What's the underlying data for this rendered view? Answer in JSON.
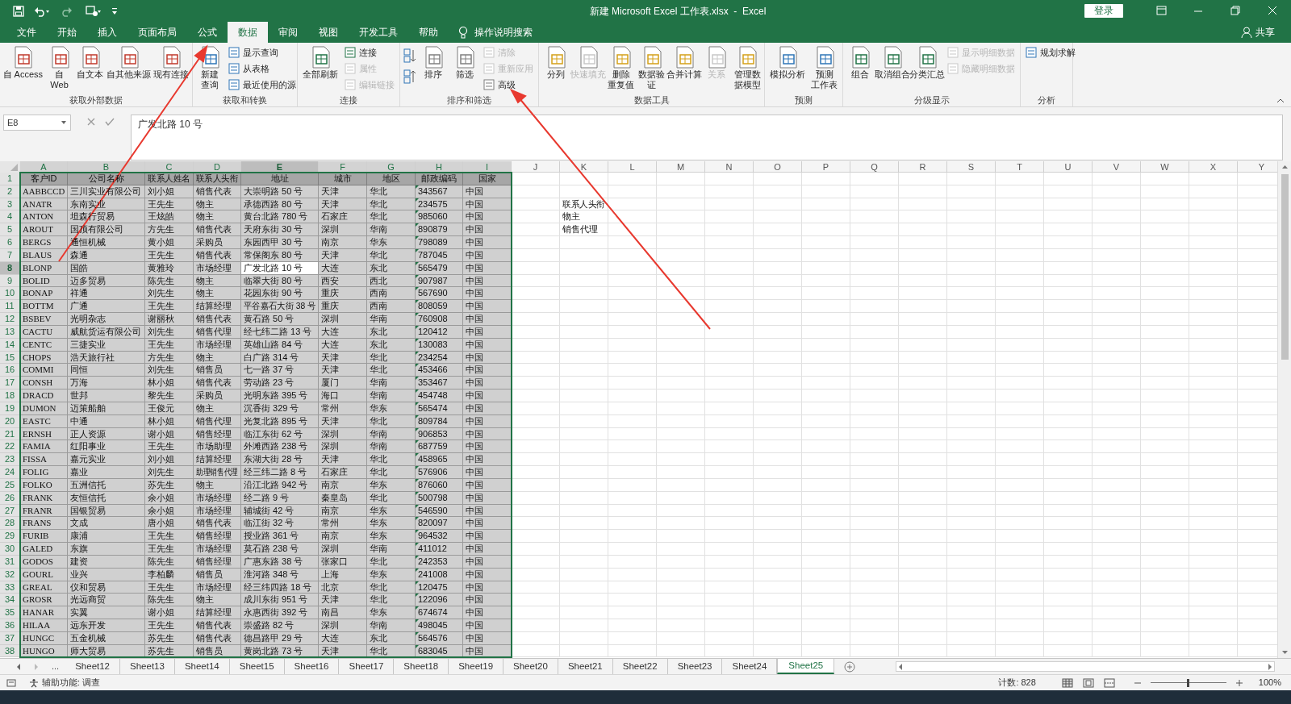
{
  "window": {
    "title": "新建 Microsoft Excel 工作表.xlsx  -  Excel",
    "sign_in": "登录"
  },
  "menu_tabs": [
    {
      "label": "文件",
      "selected": false
    },
    {
      "label": "开始",
      "selected": false
    },
    {
      "label": "插入",
      "selected": false
    },
    {
      "label": "页面布局",
      "selected": false
    },
    {
      "label": "公式",
      "selected": false
    },
    {
      "label": "数据",
      "selected": true
    },
    {
      "label": "审阅",
      "selected": false
    },
    {
      "label": "视图",
      "selected": false
    },
    {
      "label": "开发工具",
      "selected": false
    },
    {
      "label": "帮助",
      "selected": false
    }
  ],
  "tell_me": "操作说明搜索",
  "share": "共享",
  "ribbon_groups": [
    {
      "label": "获取外部数据",
      "items": [
        {
          "label": "自 Access",
          "kind": "large",
          "disabled": false
        },
        {
          "lines": [
            "自",
            "Web"
          ],
          "kind": "large",
          "disabled": false
        },
        {
          "label": "自文本",
          "kind": "large",
          "disabled": false
        },
        {
          "label": "自其他来源",
          "kind": "large",
          "disabled": false
        },
        {
          "label": "现有连接",
          "kind": "large",
          "disabled": false
        }
      ]
    },
    {
      "label": "获取和转换",
      "items": [
        {
          "lines": [
            "新建",
            "查询"
          ],
          "kind": "large",
          "disabled": false
        },
        {
          "label": "显示查询",
          "kind": "small",
          "disabled": false
        },
        {
          "label": "从表格",
          "kind": "small",
          "disabled": false
        },
        {
          "label": "最近使用的源",
          "kind": "small",
          "disabled": false
        }
      ]
    },
    {
      "label": "连接",
      "items": [
        {
          "label": "全部刷新",
          "kind": "large",
          "disabled": false
        },
        {
          "label": "连接",
          "kind": "small",
          "disabled": false
        },
        {
          "label": "属性",
          "kind": "small",
          "disabled": true
        },
        {
          "label": "编辑链接",
          "kind": "small",
          "disabled": true
        }
      ]
    },
    {
      "label": "排序和筛选",
      "items": [
        {
          "kind": "sort_pair"
        },
        {
          "label": "排序",
          "kind": "large",
          "disabled": false
        },
        {
          "label": "筛选",
          "kind": "large",
          "disabled": false
        },
        {
          "label": "清除",
          "kind": "small",
          "disabled": true
        },
        {
          "label": "重新应用",
          "kind": "small",
          "disabled": true
        },
        {
          "label": "高级",
          "kind": "small",
          "disabled": false
        }
      ]
    },
    {
      "label": "数据工具",
      "items": [
        {
          "label": "分列",
          "kind": "large",
          "disabled": false
        },
        {
          "label": "快速填充",
          "kind": "large",
          "disabled": true
        },
        {
          "lines": [
            "删除",
            "重复值"
          ],
          "kind": "large",
          "disabled": false
        },
        {
          "lines": [
            "数据验",
            "证"
          ],
          "kind": "large",
          "disabled": false
        },
        {
          "label": "合并计算",
          "kind": "large",
          "disabled": false
        },
        {
          "label": "关系",
          "kind": "large",
          "disabled": true
        },
        {
          "lines": [
            "管理数",
            "据模型"
          ],
          "kind": "large",
          "disabled": false
        }
      ]
    },
    {
      "label": "预测",
      "items": [
        {
          "label": "模拟分析",
          "kind": "large",
          "disabled": false
        },
        {
          "lines": [
            "预测",
            "工作表"
          ],
          "kind": "large",
          "disabled": false
        }
      ]
    },
    {
      "label": "分级显示",
      "items": [
        {
          "label": "组合",
          "kind": "large",
          "disabled": false
        },
        {
          "label": "取消组合",
          "kind": "large",
          "disabled": false
        },
        {
          "label": "分类汇总",
          "kind": "large",
          "disabled": false
        },
        {
          "label": "显示明细数据",
          "kind": "small",
          "disabled": true
        },
        {
          "label": "隐藏明细数据",
          "kind": "small",
          "disabled": true
        }
      ]
    },
    {
      "label": "分析",
      "items": [
        {
          "label": "规划求解",
          "kind": "small",
          "disabled": false
        }
      ]
    }
  ],
  "name_box": "E8",
  "formula": "广发北路 10 号",
  "sheet": {
    "column_letters": [
      {
        "label": "A",
        "selected": false
      },
      {
        "label": "B",
        "selected": false
      },
      {
        "label": "C",
        "selected": false
      },
      {
        "label": "D",
        "selected": false
      },
      {
        "label": "E",
        "selected": true
      },
      {
        "label": "F",
        "selected": false
      },
      {
        "label": "G",
        "selected": false
      },
      {
        "label": "H",
        "selected": false
      },
      {
        "label": "I",
        "selected": false
      },
      {
        "label": "J",
        "selected": false
      },
      {
        "label": "K",
        "selected": false
      },
      {
        "label": "L",
        "selected": false
      },
      {
        "label": "M",
        "selected": false
      },
      {
        "label": "N",
        "selected": false
      },
      {
        "label": "O",
        "selected": false
      },
      {
        "label": "P",
        "selected": false
      },
      {
        "label": "Q",
        "selected": false
      },
      {
        "label": "R",
        "selected": false
      },
      {
        "label": "S",
        "selected": false
      },
      {
        "label": "T",
        "selected": false
      },
      {
        "label": "U",
        "selected": false
      },
      {
        "label": "V",
        "selected": false
      },
      {
        "label": "W",
        "selected": false
      },
      {
        "label": "X",
        "selected": false
      },
      {
        "label": "Y",
        "selected": false
      }
    ],
    "header": [
      "客户ID",
      "公司名称",
      "联系人姓名",
      "联系人头衔",
      "地址",
      "城市",
      "地区",
      "邮政编码",
      "国家"
    ],
    "rows": [
      {
        "number": "2",
        "selected": false,
        "cells": [
          "AABBCCD",
          "三川实业有限公司",
          "刘小姐",
          "销售代表",
          "大崇明路 50 号",
          "天津",
          "华北",
          "343567",
          "中国"
        ]
      },
      {
        "number": "3",
        "selected": false,
        "cells": [
          "ANATR",
          "东南实业",
          "王先生",
          "物主",
          "承德西路 80 号",
          "天津",
          "华北",
          "234575",
          "中国"
        ]
      },
      {
        "number": "4",
        "selected": false,
        "cells": [
          "ANTON",
          "坦森行贸易",
          "王炫皓",
          "物主",
          "黄台北路 780 号",
          "石家庄",
          "华北",
          "985060",
          "中国"
        ]
      },
      {
        "number": "5",
        "selected": false,
        "cells": [
          "AROUT",
          "国顶有限公司",
          "方先生",
          "销售代表",
          "天府东街 30 号",
          "深圳",
          "华南",
          "890879",
          "中国"
        ]
      },
      {
        "number": "6",
        "selected": false,
        "cells": [
          "BERGS",
          "通恒机械",
          "黄小姐",
          "采购员",
          "东园西甲 30 号",
          "南京",
          "华东",
          "798089",
          "中国"
        ]
      },
      {
        "number": "7",
        "selected": false,
        "cells": [
          "BLAUS",
          "森通",
          "王先生",
          "销售代表",
          "常保阁东 80 号",
          "天津",
          "华北",
          "787045",
          "中国"
        ]
      },
      {
        "number": "8",
        "selected": true,
        "cells": [
          "BLONP",
          "国皓",
          "黄雅玲",
          "市场经理",
          "广发北路 10 号",
          "大连",
          "东北",
          "565479",
          "中国"
        ]
      },
      {
        "number": "9",
        "selected": false,
        "cells": [
          "BOLID",
          "迈多贸易",
          "陈先生",
          "物主",
          "临翠大街 80 号",
          "西安",
          "西北",
          "907987",
          "中国"
        ]
      },
      {
        "number": "10",
        "selected": false,
        "cells": [
          "BONAP",
          "祥通",
          "刘先生",
          "物主",
          "花园东街 90 号",
          "重庆",
          "西南",
          "567690",
          "中国"
        ]
      },
      {
        "number": "11",
        "selected": false,
        "cells": [
          "BOTTM",
          "广通",
          "王先生",
          "结算经理",
          "平谷嘉石大街 38 号",
          "重庆",
          "西南",
          "808059",
          "中国"
        ]
      },
      {
        "number": "12",
        "selected": false,
        "cells": [
          "BSBEV",
          "光明杂志",
          "谢丽秋",
          "销售代表",
          "黄石路 50 号",
          "深圳",
          "华南",
          "760908",
          "中国"
        ]
      },
      {
        "number": "13",
        "selected": false,
        "cells": [
          "CACTU",
          "威航货运有限公司",
          "刘先生",
          "销售代理",
          "经七纬二路 13 号",
          "大连",
          "东北",
          "120412",
          "中国"
        ]
      },
      {
        "number": "14",
        "selected": false,
        "cells": [
          "CENTC",
          "三捷实业",
          "王先生",
          "市场经理",
          "英雄山路 84 号",
          "大连",
          "东北",
          "130083",
          "中国"
        ]
      },
      {
        "number": "15",
        "selected": false,
        "cells": [
          "CHOPS",
          "浩天旅行社",
          "方先生",
          "物主",
          "白广路 314 号",
          "天津",
          "华北",
          "234254",
          "中国"
        ]
      },
      {
        "number": "16",
        "selected": false,
        "cells": [
          "COMMI",
          "同恒",
          "刘先生",
          "销售员",
          "七一路 37 号",
          "天津",
          "华北",
          "453466",
          "中国"
        ]
      },
      {
        "number": "17",
        "selected": false,
        "cells": [
          "CONSH",
          "万海",
          "林小姐",
          "销售代表",
          "劳动路 23 号",
          "厦门",
          "华南",
          "353467",
          "中国"
        ]
      },
      {
        "number": "18",
        "selected": false,
        "cells": [
          "DRACD",
          "世邦",
          "黎先生",
          "采购员",
          "光明东路 395 号",
          "海口",
          "华南",
          "454748",
          "中国"
        ]
      },
      {
        "number": "19",
        "selected": false,
        "cells": [
          "DUMON",
          "迈策船舶",
          "王俊元",
          "物主",
          "沉香街 329 号",
          "常州",
          "华东",
          "565474",
          "中国"
        ]
      },
      {
        "number": "20",
        "selected": false,
        "cells": [
          "EASTC",
          "中通",
          "林小姐",
          "销售代理",
          "光复北路 895 号",
          "天津",
          "华北",
          "809784",
          "中国"
        ]
      },
      {
        "number": "21",
        "selected": false,
        "cells": [
          "ERNSH",
          "正人资源",
          "谢小姐",
          "销售经理",
          "临江东街 62 号",
          "深圳",
          "华南",
          "906853",
          "中国"
        ]
      },
      {
        "number": "22",
        "selected": false,
        "cells": [
          "FAMIA",
          "红阳事业",
          "王先生",
          "市场助理",
          "外滩西路 238 号",
          "深圳",
          "华南",
          "687759",
          "中国"
        ]
      },
      {
        "number": "23",
        "selected": false,
        "cells": [
          "FISSA",
          "嘉元实业",
          "刘小姐",
          "结算经理",
          "东湖大街 28 号",
          "天津",
          "华北",
          "458965",
          "中国"
        ]
      },
      {
        "number": "24",
        "selected": false,
        "cells": [
          "FOLIG",
          "嘉业",
          "刘先生",
          "助理销售代理",
          "经三纬二路 8 号",
          "石家庄",
          "华北",
          "576906",
          "中国"
        ]
      },
      {
        "number": "25",
        "selected": false,
        "cells": [
          "FOLKO",
          "五洲信托",
          "苏先生",
          "物主",
          "沿江北路 942 号",
          "南京",
          "华东",
          "876060",
          "中国"
        ]
      },
      {
        "number": "26",
        "selected": false,
        "cells": [
          "FRANK",
          "友恒信托",
          "余小姐",
          "市场经理",
          "经二路 9 号",
          "秦皇岛",
          "华北",
          "500798",
          "中国"
        ]
      },
      {
        "number": "27",
        "selected": false,
        "cells": [
          "FRANR",
          "国银贸易",
          "余小姐",
          "市场经理",
          "辅城街 42 号",
          "南京",
          "华东",
          "546590",
          "中国"
        ]
      },
      {
        "number": "28",
        "selected": false,
        "cells": [
          "FRANS",
          "文成",
          "唐小姐",
          "销售代表",
          "临江街 32 号",
          "常州",
          "华东",
          "820097",
          "中国"
        ]
      },
      {
        "number": "29",
        "selected": false,
        "cells": [
          "FURIB",
          "康浦",
          "王先生",
          "销售经理",
          "授业路 361 号",
          "南京",
          "华东",
          "964532",
          "中国"
        ]
      },
      {
        "number": "30",
        "selected": false,
        "cells": [
          "GALED",
          "东旗",
          "王先生",
          "市场经理",
          "莫石路 238 号",
          "深圳",
          "华南",
          "411012",
          "中国"
        ]
      },
      {
        "number": "31",
        "selected": false,
        "cells": [
          "GODOS",
          "建资",
          "陈先生",
          "销售经理",
          "广惠东路 38 号",
          "张家口",
          "华北",
          "242353",
          "中国"
        ]
      },
      {
        "number": "32",
        "selected": false,
        "cells": [
          "GOURL",
          "业兴",
          "李柏麟",
          "销售员",
          "淮河路 348 号",
          "上海",
          "华东",
          "241008",
          "中国"
        ]
      },
      {
        "number": "33",
        "selected": false,
        "cells": [
          "GREAL",
          "仪和贸易",
          "王先生",
          "市场经理",
          "经三纬四路 18 号",
          "北京",
          "华北",
          "120475",
          "中国"
        ]
      },
      {
        "number": "34",
        "selected": false,
        "cells": [
          "GROSR",
          "光远商贸",
          "陈先生",
          "物主",
          "成川东街 951 号",
          "天津",
          "华北",
          "122096",
          "中国"
        ]
      },
      {
        "number": "35",
        "selected": false,
        "cells": [
          "HANAR",
          "实翼",
          "谢小姐",
          "结算经理",
          "永惠西街 392 号",
          "南昌",
          "华东",
          "674674",
          "中国"
        ]
      },
      {
        "number": "36",
        "selected": false,
        "cells": [
          "HILAA",
          "远东开发",
          "王先生",
          "销售代表",
          "崇盛路 82 号",
          "深圳",
          "华南",
          "498045",
          "中国"
        ]
      },
      {
        "number": "37",
        "selected": false,
        "cells": [
          "HUNGC",
          "五金机械",
          "苏先生",
          "销售代表",
          "德昌路甲 29 号",
          "大连",
          "东北",
          "564576",
          "中国"
        ]
      },
      {
        "number": "38",
        "selected": false,
        "cells": [
          "HUNGO",
          "师大贸易",
          "苏先生",
          "销售员",
          "黄岗北路 73 号",
          "天津",
          "华北",
          "683045",
          "中国"
        ]
      }
    ],
    "header_number": "1",
    "criteria_cells": [
      "联系人头衔",
      "物主",
      "销售代理"
    ]
  },
  "sheet_nav_more": "...",
  "sheet_tabs": [
    {
      "label": "Sheet12",
      "selected": false
    },
    {
      "label": "Sheet13",
      "selected": false
    },
    {
      "label": "Sheet14",
      "selected": false
    },
    {
      "label": "Sheet15",
      "selected": false
    },
    {
      "label": "Sheet16",
      "selected": false
    },
    {
      "label": "Sheet17",
      "selected": false
    },
    {
      "label": "Sheet18",
      "selected": false
    },
    {
      "label": "Sheet19",
      "selected": false
    },
    {
      "label": "Sheet20",
      "selected": false
    },
    {
      "label": "Sheet21",
      "selected": false
    },
    {
      "label": "Sheet22",
      "selected": false
    },
    {
      "label": "Sheet23",
      "selected": false
    },
    {
      "label": "Sheet24",
      "selected": false
    },
    {
      "label": "Sheet25",
      "selected": true
    }
  ],
  "status_bar": {
    "accessibility": "辅助功能: 调查",
    "count": "计数: 828",
    "zoom": "100%",
    "zoom_slider": {
      "level": 0.5
    }
  }
}
